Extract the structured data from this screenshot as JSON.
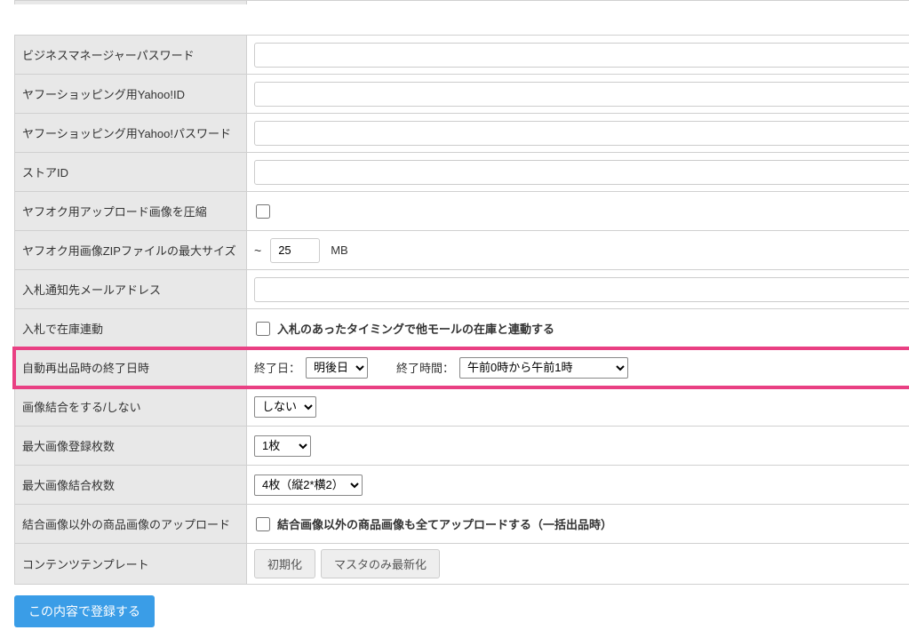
{
  "rows": {
    "bm_password": {
      "label": "ビジネスマネージャーパスワード",
      "value": ""
    },
    "yshop_id": {
      "label": "ヤフーショッピング用Yahoo!ID",
      "value": ""
    },
    "yshop_password": {
      "label": "ヤフーショッピング用Yahoo!パスワード",
      "value": ""
    },
    "store_id": {
      "label": "ストアID",
      "value": ""
    },
    "compress_img": {
      "label": "ヤフオク用アップロード画像を圧縮"
    },
    "zip_max": {
      "label": "ヤフオク用画像ZIPファイルの最大サイズ",
      "prefix": "~",
      "value": "25",
      "suffix": "MB"
    },
    "notify_email": {
      "label": "入札通知先メールアドレス",
      "value": ""
    },
    "stock_link": {
      "label": "入札で在庫連動",
      "checkbox_label": "入札のあったタイミングで他モールの在庫と連動する"
    },
    "relist_end": {
      "label": "自動再出品時の終了日時",
      "end_date_label": "終了日：",
      "end_date_value": "明後日",
      "end_time_label": "終了時間：",
      "end_time_value": "午前0時から午前1時"
    },
    "merge_img": {
      "label": "画像結合をする/しない",
      "value": "しない"
    },
    "max_img_count": {
      "label": "最大画像登録枚数",
      "value": "1枚"
    },
    "max_merge_count": {
      "label": "最大画像結合枚数",
      "value": "4枚（縦2*横2）"
    },
    "upload_non_merge": {
      "label": "結合画像以外の商品画像のアップロード",
      "checkbox_label": "結合画像以外の商品画像も全てアップロードする（一括出品時）"
    },
    "content_template": {
      "label": "コンテンツテンプレート",
      "btn_init": "初期化",
      "btn_master": "マスタのみ最新化"
    }
  },
  "submit_label": "この内容で登録する"
}
